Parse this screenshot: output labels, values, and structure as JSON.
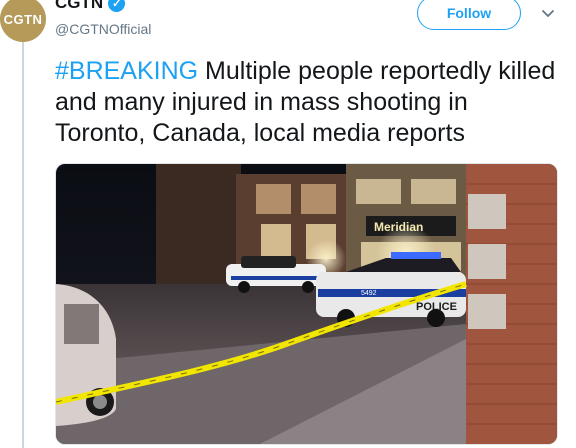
{
  "tweet": {
    "display_name": "CGTN",
    "handle": "@CGTNOfficial",
    "avatar_text": "CGTN",
    "verified_icon": "verified-badge-icon",
    "follow_label": "Follow",
    "text_hashtag": "#BREAKING",
    "text_body": " Multiple people reportedly killed and many injured in mass shooting in Toronto, Canada, local media reports"
  },
  "media": {
    "storefront_sign": "Meridian",
    "police_car_lettering": "POLICE",
    "car_number": "5492"
  },
  "colors": {
    "accent": "#1da1f2",
    "avatar_bg": "#b59a5a",
    "tape": "#f2e600"
  }
}
